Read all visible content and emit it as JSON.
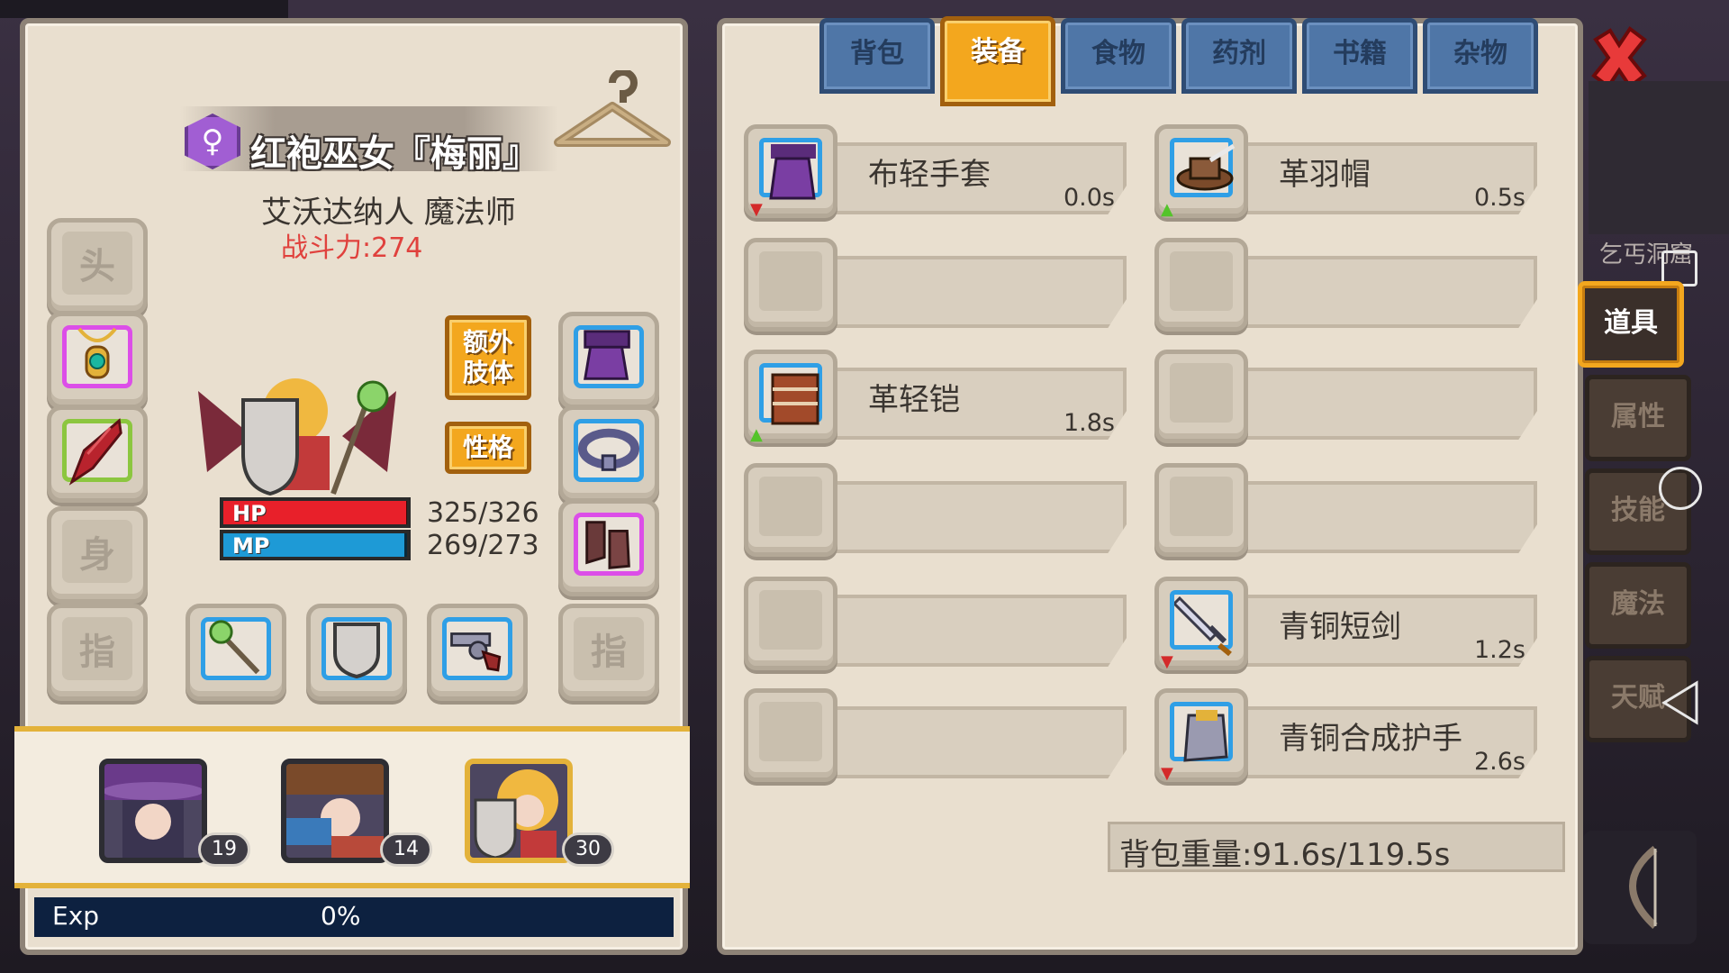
{
  "character": {
    "gender_symbol": "♀",
    "name": "红袍巫女『梅丽』",
    "subtitle": "艾沃达纳人 魔法师",
    "power": "战斗力:274"
  },
  "slots": {
    "head": "头",
    "body": "身",
    "ring_left": "指",
    "ring_right": "指"
  },
  "buttons": {
    "extra_limb": "额外\n肢体",
    "personality": "性格"
  },
  "stats": {
    "hp_label": "HP",
    "hp_value": "325/326",
    "hp_fraction": 0.997,
    "mp_label": "MP",
    "mp_value": "269/273",
    "mp_fraction": 0.985
  },
  "team": {
    "members": [
      {
        "level": "19"
      },
      {
        "level": "14"
      },
      {
        "level": "30"
      }
    ]
  },
  "exp": {
    "label": "Exp",
    "value": "0%"
  },
  "tabs": [
    "背包",
    "装备",
    "食物",
    "药剂",
    "书籍",
    "杂物"
  ],
  "active_tab": "装备",
  "items_left": [
    {
      "name": "布轻手套",
      "weight": "0.0s",
      "arrow": "down"
    },
    {
      "name": "",
      "weight": ""
    },
    {
      "name": "革轻铠",
      "weight": "1.8s",
      "arrow": "up"
    },
    {
      "name": "",
      "weight": ""
    },
    {
      "name": "",
      "weight": ""
    },
    {
      "name": "",
      "weight": ""
    }
  ],
  "items_right": [
    {
      "name": "革羽帽",
      "weight": "0.5s",
      "arrow": "up"
    },
    {
      "name": "",
      "weight": ""
    },
    {
      "name": "",
      "weight": ""
    },
    {
      "name": "",
      "weight": ""
    },
    {
      "name": "青铜短剑",
      "weight": "1.2s",
      "arrow": "down"
    },
    {
      "name": "青铜合成护手",
      "weight": "2.6s",
      "arrow": "down"
    }
  ],
  "bag_weight": "背包重量:91.6s/119.5s",
  "map_label": "乞丐洞窟",
  "side_tabs": [
    "道具",
    "属性",
    "技能",
    "魔法",
    "天赋"
  ],
  "active_side_tab": "道具",
  "colors": {
    "accent_orange": "#f3a71e",
    "tab_blue": "#4f76a7",
    "hp_red": "#e8202a",
    "mp_blue": "#1e9ad6",
    "power_red": "#e0413d",
    "panel_bg": "#e9dfcf"
  },
  "icons": {
    "close": "close-x-icon",
    "hanger": "hanger-icon",
    "bow": "bow-icon"
  }
}
